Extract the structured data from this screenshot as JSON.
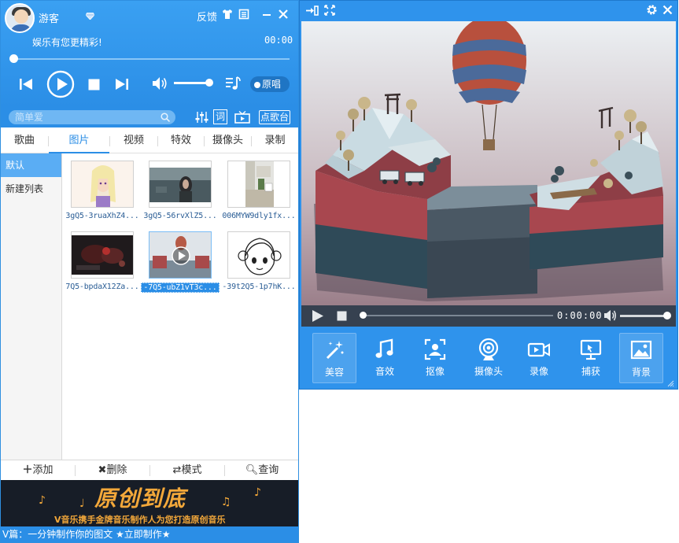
{
  "player": {
    "username": "游客",
    "feedback_label": "反馈",
    "slogan": "娱乐有您更精彩!",
    "time": "00:00",
    "original_label": "原唱",
    "progress": 0,
    "volume": 0.9
  },
  "search": {
    "placeholder": "简单爱",
    "request_label": "点歌台",
    "lyrics_label": "词"
  },
  "tabs": [
    "歌曲",
    "图片",
    "视频",
    "特效",
    "摄像头",
    "录制"
  ],
  "active_tab": 1,
  "sidebar": {
    "items": [
      "默认",
      "新建列表"
    ],
    "active": 0
  },
  "grid": {
    "items": [
      {
        "caption": "3gQ5-3ruaXhZ4..."
      },
      {
        "caption": "3gQ5-56rvXlZ5..."
      },
      {
        "caption": "006MYW9dly1fx..."
      },
      {
        "caption": "7Q5-bpdaX12Za..."
      },
      {
        "caption": "-7Q5-ubZ1vT3c..."
      },
      {
        "caption": "-39t2Q5-1p7hK..."
      }
    ],
    "selected": 4
  },
  "bottom_toolbar": {
    "add": "添加",
    "delete": "删除",
    "mode": "模式",
    "query": "查询"
  },
  "banner": {
    "title": "原创到底",
    "subtitle": "V音乐携手金牌音乐制作人为您打造原创音乐"
  },
  "ticker": "V篇：一分钟制作你的图文 ★立即制作★",
  "video": {
    "time": "0:00:00",
    "progress": 0,
    "volume": 0.95
  },
  "effects": {
    "items": [
      "美容",
      "音效",
      "抠像",
      "摄像头",
      "录像",
      "捕获",
      "背景"
    ],
    "active": [
      0,
      6
    ]
  },
  "colors": {
    "accent": "#2b8ee6",
    "banner_text": "#f3a83a",
    "video_bar": "#364150"
  }
}
